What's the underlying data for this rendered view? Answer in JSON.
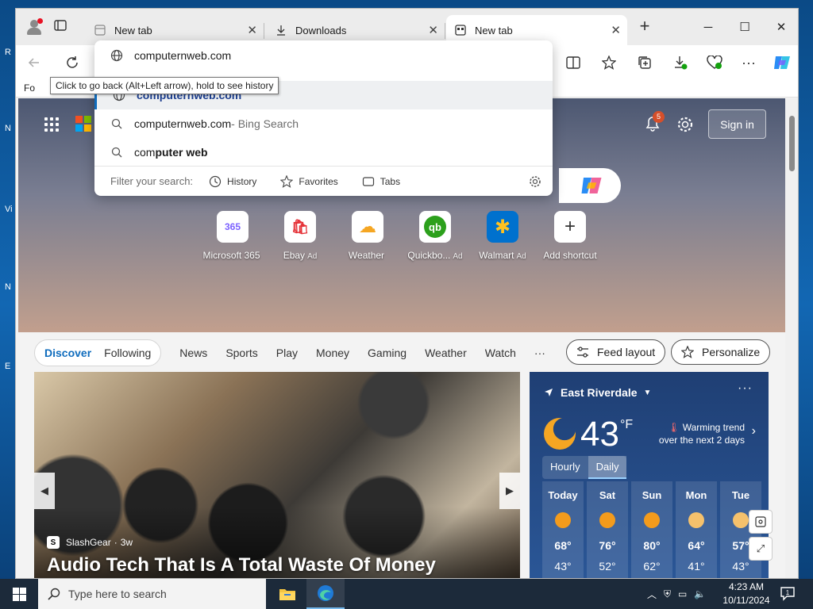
{
  "desktop": {
    "side_letters": [
      "R",
      "N",
      "Vi",
      "N",
      "E"
    ]
  },
  "tabs": [
    {
      "label": "New tab",
      "icon": "newtab-icon",
      "active": false
    },
    {
      "label": "Downloads",
      "icon": "download-icon",
      "active": false
    },
    {
      "label": "New tab",
      "icon": "newtab-icon",
      "active": true
    }
  ],
  "favbar": {
    "label": "Fo"
  },
  "tooltip": {
    "text": "Click to go back (Alt+Left arrow), hold to see history"
  },
  "omnibox": {
    "input": "computernweb.com",
    "suggestions": [
      {
        "text": "computernweb.com",
        "suffix": "",
        "icon": "globe-icon"
      },
      {
        "text": "computernweb.com",
        "suffix": " - Bing Search",
        "icon": "search-icon"
      },
      {
        "prefix": "com",
        "bold": "puter web",
        "icon": "search-icon"
      }
    ],
    "filter_label": "Filter your search:",
    "filters": [
      "History",
      "Favorites",
      "Tabs"
    ]
  },
  "newtab": {
    "notification_count": "5",
    "signin_label": "Sign in",
    "shortcuts": [
      {
        "label": "Microsoft 365",
        "ad": "",
        "glyph": "365",
        "color": "#7b61ff"
      },
      {
        "label": "Ebay",
        "ad": "Ad",
        "glyph": "🛍",
        "color": "#e53238"
      },
      {
        "label": "Weather",
        "ad": "",
        "glyph": "☁",
        "color": "#f5a623"
      },
      {
        "label": "Quickbo...",
        "ad": "Ad",
        "glyph": "qb",
        "color": "#2ca01c"
      },
      {
        "label": "Walmart",
        "ad": "Ad",
        "glyph": "✱",
        "color": "#0071ce"
      },
      {
        "label": "Add shortcut",
        "ad": "",
        "glyph": "+",
        "color": "#333333"
      }
    ]
  },
  "feed": {
    "pill_tabs": [
      "Discover",
      "Following"
    ],
    "tabs": [
      "News",
      "Sports",
      "Play",
      "Money",
      "Gaming",
      "Weather",
      "Watch",
      "···"
    ],
    "feed_layout_label": "Feed layout",
    "personalize_label": "Personalize",
    "hero": {
      "source": "SlashGear",
      "age": "3w",
      "title": "Audio Tech That Is A Total Waste Of Money"
    }
  },
  "weather": {
    "location": "East Riverdale",
    "temp": "43",
    "unit": "°F",
    "trend_line1": "Warming trend",
    "trend_line2": "over the next 2 days",
    "toggle": [
      "Hourly",
      "Daily"
    ],
    "days": [
      {
        "name": "Today",
        "hi": "68°",
        "lo": "43°"
      },
      {
        "name": "Sat",
        "hi": "76°",
        "lo": "52°"
      },
      {
        "name": "Sun",
        "hi": "80°",
        "lo": "62°"
      },
      {
        "name": "Mon",
        "hi": "64°",
        "lo": "41°"
      },
      {
        "name": "Tue",
        "hi": "57°",
        "lo": "43°"
      }
    ]
  },
  "taskbar": {
    "search_placeholder": "Type here to search",
    "time": "4:23 AM",
    "date": "10/11/2024",
    "notification_count": "1"
  }
}
